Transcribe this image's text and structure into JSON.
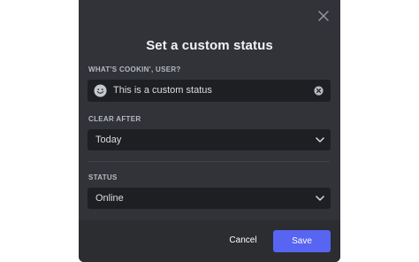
{
  "modal": {
    "title": "Set a custom status"
  },
  "status_field": {
    "label": "WHAT'S COOKIN', USER?",
    "value": "This is a custom status",
    "emoji_icon": "smile-emoji-icon",
    "clear_icon": "clear-circle-x-icon"
  },
  "clear_after": {
    "label": "CLEAR AFTER",
    "selected": "Today"
  },
  "status": {
    "label": "STATUS",
    "selected": "Online"
  },
  "footer": {
    "cancel_label": "Cancel",
    "save_label": "Save"
  },
  "colors": {
    "modal_bg": "#313338",
    "footer_bg": "#2b2d31",
    "input_bg": "#1e1f22",
    "accent": "#5865f2",
    "label": "#b5bac1",
    "text": "#dbdee1"
  }
}
